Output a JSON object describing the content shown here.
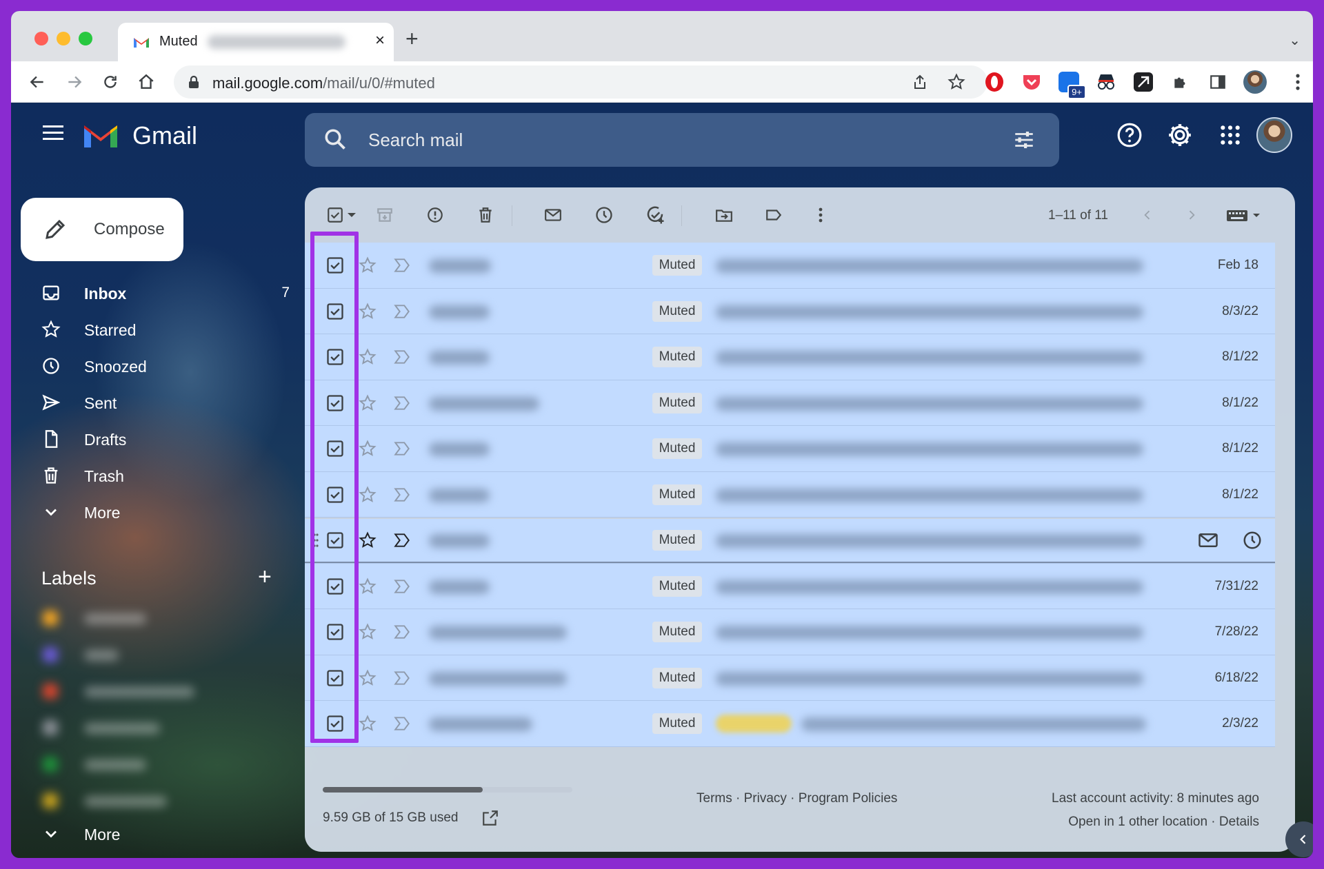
{
  "browser": {
    "tab_title": "Muted",
    "tab_close": "×",
    "new_tab": "+",
    "tab_list": "⌄",
    "url_domain": "mail.google.com",
    "url_path": "/mail/u/0/#muted",
    "extension_badge": "9+"
  },
  "gmail": {
    "wordmark": "Gmail",
    "search_placeholder": "Search mail",
    "compose_label": "Compose",
    "nav": [
      {
        "label": "Inbox",
        "count": "7",
        "icon": "inbox-icon"
      },
      {
        "label": "Starred",
        "count": "",
        "icon": "star-icon"
      },
      {
        "label": "Snoozed",
        "count": "",
        "icon": "clock-icon"
      },
      {
        "label": "Sent",
        "count": "",
        "icon": "send-icon"
      },
      {
        "label": "Drafts",
        "count": "",
        "icon": "draft-icon"
      },
      {
        "label": "Trash",
        "count": "",
        "icon": "trash-icon"
      },
      {
        "label": "More",
        "count": "",
        "icon": "chevron-down-icon"
      }
    ],
    "labels_title": "Labels",
    "labels_add": "+",
    "labels_more": "More",
    "label_colors": [
      "#f5a623",
      "#6b5bd6",
      "#d9452e",
      "#8a8f96",
      "#1e8f3a",
      "#c8a21e"
    ]
  },
  "toolbar": {
    "pager": "1–11 of 11"
  },
  "emails": [
    {
      "status": "Muted",
      "date": "Feb 18",
      "sender_width": 90
    },
    {
      "status": "Muted",
      "date": "8/3/22",
      "sender_width": 88
    },
    {
      "status": "Muted",
      "date": "8/1/22",
      "sender_width": 88
    },
    {
      "status": "Muted",
      "date": "8/1/22",
      "sender_width": 160
    },
    {
      "status": "Muted",
      "date": "8/1/22",
      "sender_width": 88
    },
    {
      "status": "Muted",
      "date": "8/1/22",
      "sender_width": 88
    },
    {
      "status": "Muted",
      "date": "",
      "sender_width": 88
    },
    {
      "status": "Muted",
      "date": "7/31/22",
      "sender_width": 88
    },
    {
      "status": "Muted",
      "date": "7/28/22",
      "sender_width": 200
    },
    {
      "status": "Muted",
      "date": "6/18/22",
      "sender_width": 200
    },
    {
      "status": "Muted",
      "date": "2/3/22",
      "sender_width": 150
    }
  ],
  "footer": {
    "storage": "9.59 GB of 15 GB used",
    "storage_fraction": 0.64,
    "links": "Terms · Privacy · Program Policies",
    "activity": "Last account activity: 8 minutes ago",
    "activity2": "Open in 1 other location · Details"
  },
  "colors": {
    "highlight": "#a132e6",
    "selected_row": "#c2dbff",
    "brand_red": "#ea4335"
  }
}
